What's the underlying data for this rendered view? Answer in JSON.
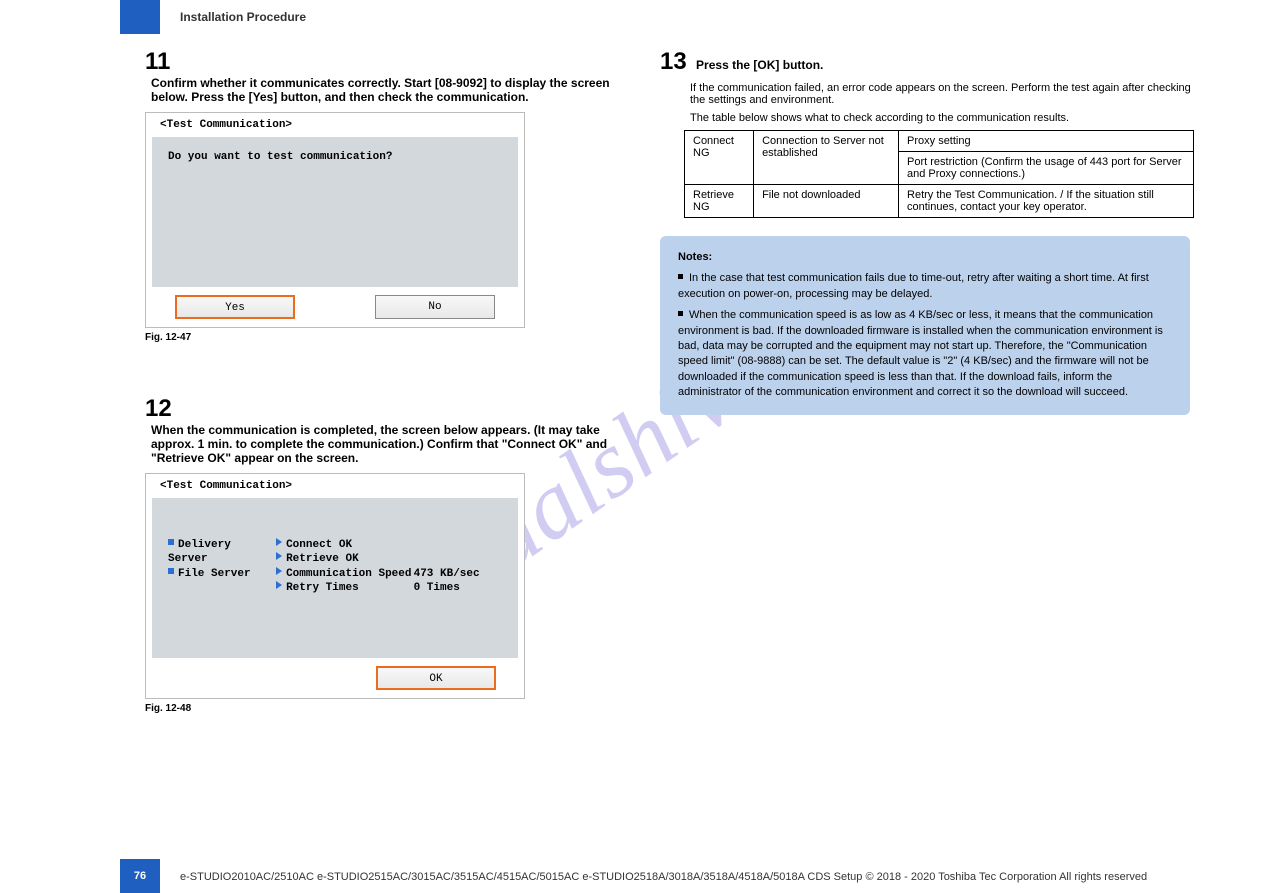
{
  "watermark": "manualshive.com",
  "page": {
    "header": "Installation Procedure",
    "number": "76",
    "footer_text": "e-STUDIO2010AC/2510AC   e-STUDIO2515AC/3015AC/3515AC/4515AC/5015AC   e-STUDIO2518A/3018A/3518A/4518A/5018A   CDS Setup © 2018 - 2020 Toshiba Tec Corporation All rights reserved"
  },
  "step11": {
    "num": "11",
    "text": "Confirm whether it communicates correctly. Start [08-9092] to display the screen below. Press the [Yes] button, and then check the communication.",
    "dialog_title": "<Test Communication>",
    "prompt": "Do you want to test communication?",
    "yes": "Yes",
    "no": "No",
    "fig": "Fig. 12-47"
  },
  "step12": {
    "num": "12",
    "text": "When the communication is completed, the screen below appears. (It may take approx. 1 min. to complete the communication.) Confirm that \"Connect OK\" and \"Retrieve OK\" appear on the screen.",
    "dialog_title": "<Test Communication>",
    "labels": {
      "delivery": "Delivery Server",
      "file": "File Server",
      "connect": "Connect OK",
      "retrieve": "Retrieve OK",
      "speed_label": "Communication Speed",
      "speed_value": "473 KB/sec",
      "retry_label": "Retry Times",
      "retry_value": "0 Times"
    },
    "ok": "OK",
    "fig": "Fig. 12-48"
  },
  "step13": {
    "num": "13",
    "text": "Press the [OK] button.",
    "text2": "If the communication failed, an error code appears on the screen. Perform the test again after checking the settings and environment.",
    "text3": "The table below shows what to check according to the communication results."
  },
  "chk_table": {
    "r1c1": "Connect NG",
    "r1c2": "Connection to Server not established",
    "r1c3a": "Proxy setting",
    "r1c3b": "Port restriction (Confirm the usage of 443 port for Server and Proxy connections.)",
    "r2c1": "Retrieve NG",
    "r2c2": "File not downloaded",
    "r2c3": "Retry the Test Communication. / If the situation still continues, contact your key operator."
  },
  "notes": {
    "label": "Notes:",
    "n1": "In the case that test communication fails due to time-out, retry after waiting a short time. At first execution on power-on, processing may be delayed.",
    "n2": "When the communication speed is as low as 4 KB/sec or less, it means that the communication environment is bad. If the downloaded firmware is installed when the communication environment is bad, data may be corrupted and the equipment may not start up. Therefore, the \"Communication speed limit\" (08-9888) can be set. The default value is \"2\" (4 KB/sec) and the firmware will not be downloaded if the communication speed is less than that. If the download fails, inform the administrator of the communication environment and correct it so the download will succeed."
  }
}
